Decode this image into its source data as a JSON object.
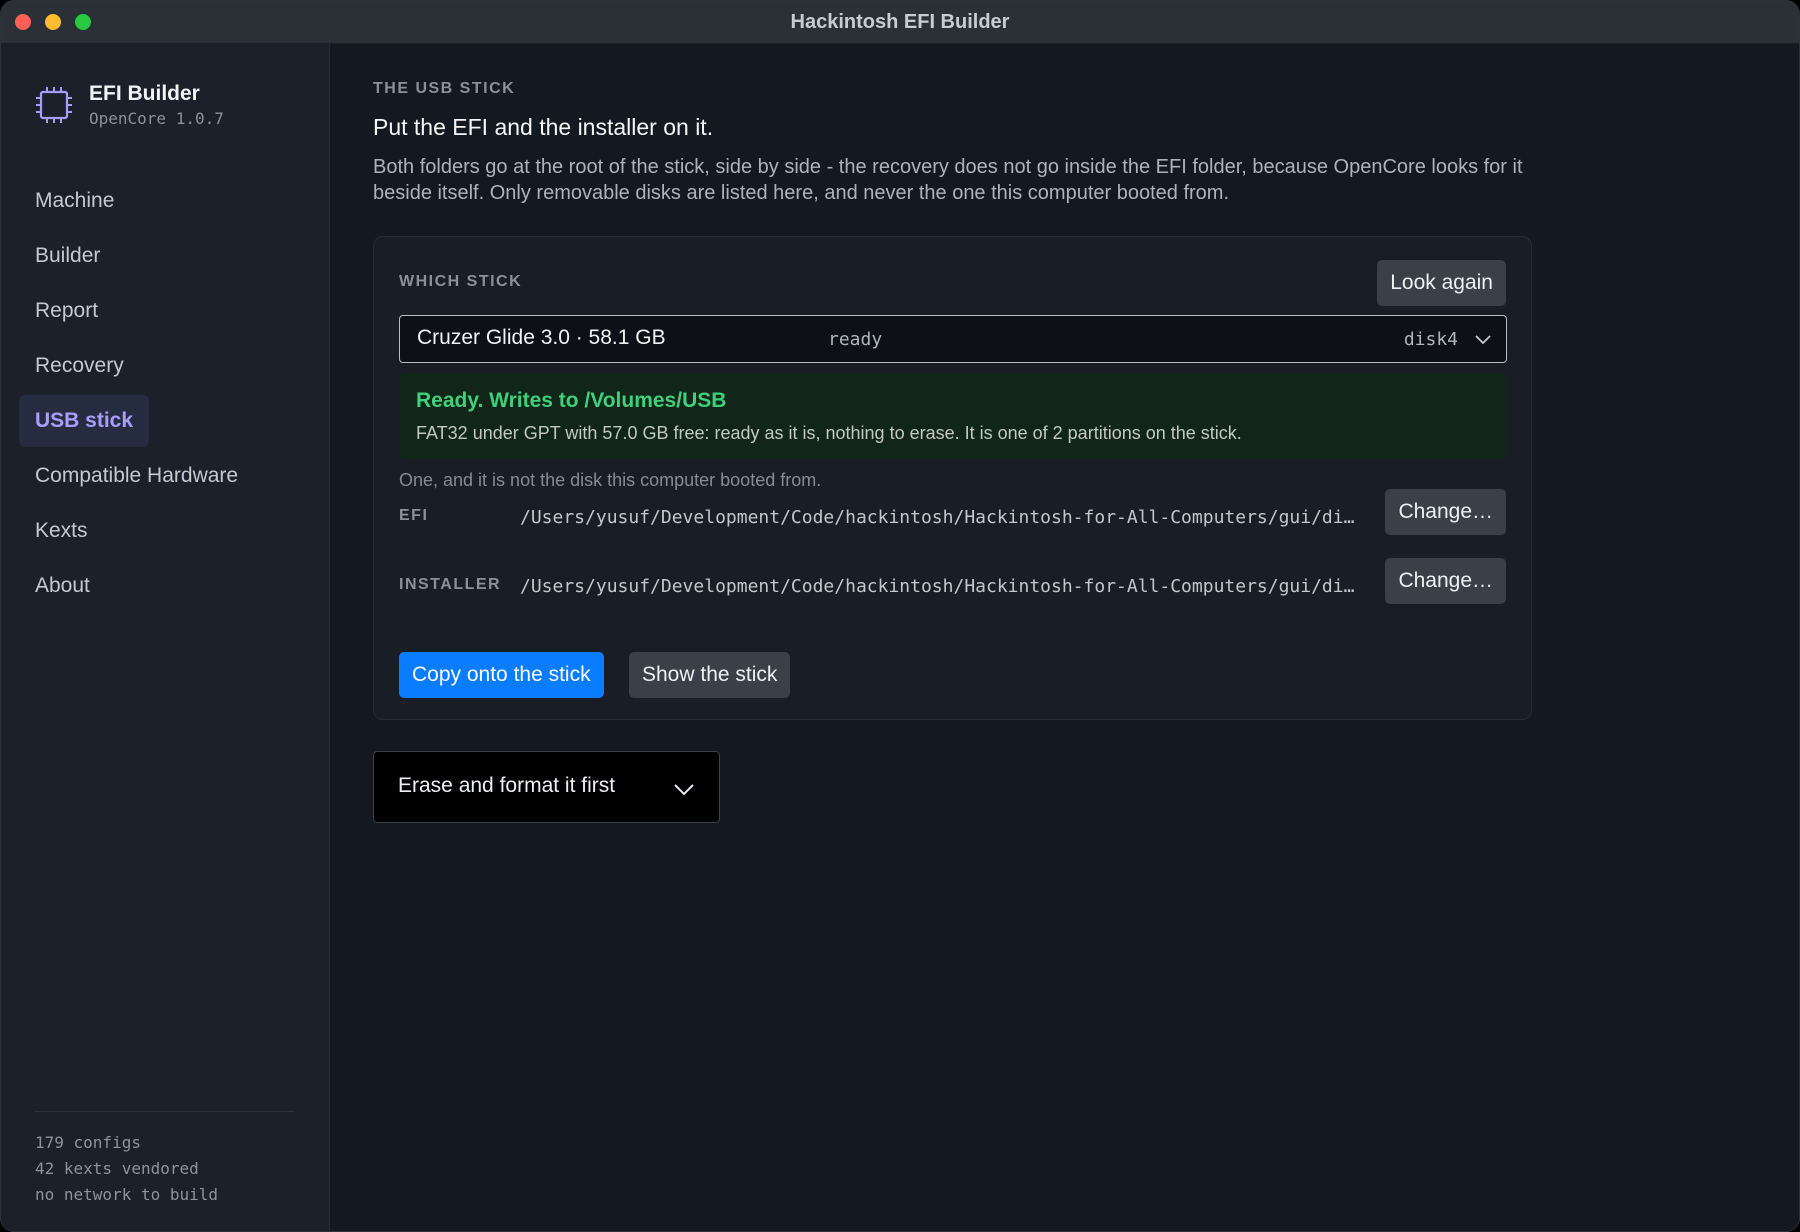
{
  "window": {
    "title": "Hackintosh EFI Builder"
  },
  "sidebar": {
    "brand_name": "EFI Builder",
    "brand_version": "OpenCore 1.0.7",
    "brand_icon": "chip-icon",
    "items": [
      {
        "label": "Machine",
        "active": false
      },
      {
        "label": "Builder",
        "active": false
      },
      {
        "label": "Report",
        "active": false
      },
      {
        "label": "Recovery",
        "active": false
      },
      {
        "label": "USB stick",
        "active": true
      },
      {
        "label": "Compatible Hardware",
        "active": false
      },
      {
        "label": "Kexts",
        "active": false
      },
      {
        "label": "About",
        "active": false
      }
    ],
    "footer": [
      "179 configs",
      "42 kexts vendored",
      "no network to build"
    ]
  },
  "main": {
    "kicker": "THE USB STICK",
    "title": "Put the EFI and the installer on it.",
    "description": "Both folders go at the root of the stick, side by side - the recovery does not go inside the EFI folder, because OpenCore looks for it beside itself. Only removable disks are listed here, and never the one this computer booted from.",
    "card": {
      "label": "WHICH STICK",
      "look_again": "Look again",
      "select": {
        "name": "Cruzer Glide 3.0 · 58.1 GB",
        "status": "ready",
        "disk": "disk4"
      },
      "status_box": {
        "title": "Ready. Writes to /Volumes/USB",
        "detail": "FAT32 under GPT with 57.0 GB free: ready as it is, nothing to erase. It is one of 2 partitions on the stick."
      },
      "hint": "One, and it is not the disk this computer booted from.",
      "efi": {
        "label": "EFI",
        "path": "/Users/yusuf/Development/Code/hackintosh/Hackintosh-for-All-Computers/gui/di…",
        "button": "Change…"
      },
      "installer": {
        "label": "INSTALLER",
        "path": "/Users/yusuf/Development/Code/hackintosh/Hackintosh-for-All-Computers/gui/di…",
        "button": "Change…"
      },
      "copy_button": "Copy onto the stick",
      "show_button": "Show the stick"
    },
    "erase_label": "Erase and format it first"
  },
  "colors": {
    "accent": "#0a7cff",
    "active_nav": "#a99cff",
    "success": "#3ed07a",
    "background": "#141820",
    "sidebar": "#1b202a"
  }
}
